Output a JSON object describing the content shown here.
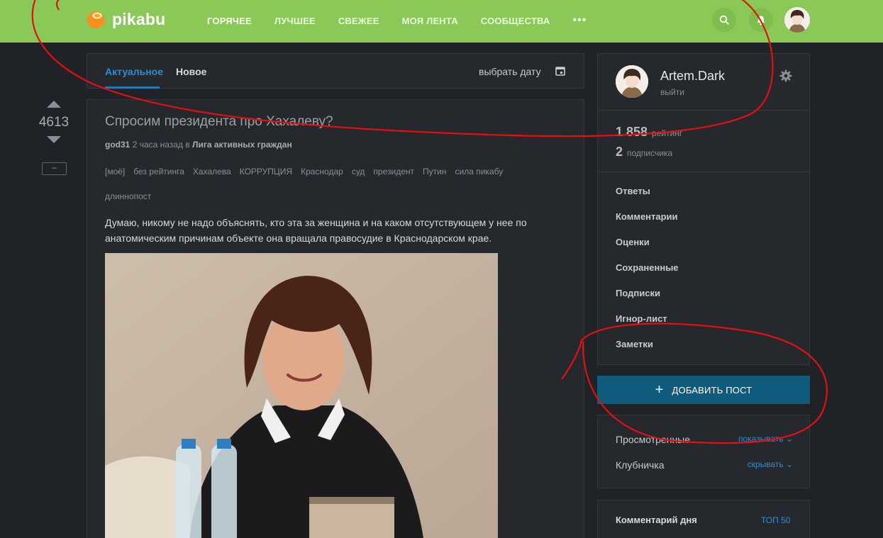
{
  "header": {
    "logo_text": "pikabu",
    "brand_color": "#8ac858",
    "nav": [
      {
        "label": "ГОРЯЧЕЕ"
      },
      {
        "label": "ЛУЧШЕЕ"
      },
      {
        "label": "СВЕЖЕЕ"
      },
      {
        "label": "МОЯ ЛЕНТА"
      },
      {
        "label": "СООБЩЕСТВА"
      }
    ],
    "more": "•••",
    "icons": [
      "search-icon",
      "bell-icon"
    ]
  },
  "vote": {
    "rating": "4613",
    "collapse": "–"
  },
  "tabs": {
    "active": "Актуальное",
    "new": "Новое",
    "date": "выбрать дату",
    "accent": "#2d8ed6"
  },
  "post": {
    "title": "Спросим президента про Хахалеву?",
    "author": "god31",
    "time": "2 часа назад в",
    "community": "Лига активных граждан",
    "tags": [
      "[моё]",
      "без рейтинга",
      "Хахалева",
      "КОРРУПЦИЯ",
      "Краснодар",
      "суд",
      "президент",
      "Путин",
      "сила пикабу",
      "длиннопост"
    ],
    "text": "Думаю, никому не надо объяснять, кто эта за женщина и на каком отсутствующем у нее по анатомическим причинам объекте она вращала правосудие в Краснодарском крае."
  },
  "profile": {
    "name": "Artem.Dark",
    "logout": "выйти",
    "rating_value": "1 858",
    "rating_label": "рейтинг",
    "subs_value": "2",
    "subs_label": "подписчика",
    "menu": [
      {
        "label": "Ответы"
      },
      {
        "label": "Комментарии"
      },
      {
        "label": "Оценки"
      },
      {
        "label": "Сохраненные"
      },
      {
        "label": "Подписки"
      },
      {
        "label": "Игнор-лист"
      },
      {
        "label": "Заметки"
      }
    ]
  },
  "add_post": {
    "plus": "+",
    "label": "ДОБАВИТЬ ПОСТ",
    "color": "#0e5b7c"
  },
  "filters": [
    {
      "label": "Просмотренные",
      "action": "показывать"
    },
    {
      "label": "Клубничка",
      "action": "скрывать"
    }
  ],
  "comment_of_day": {
    "title": "Комментарий дня",
    "link": "ТОП 50"
  },
  "annotation_color": "#e3100f"
}
